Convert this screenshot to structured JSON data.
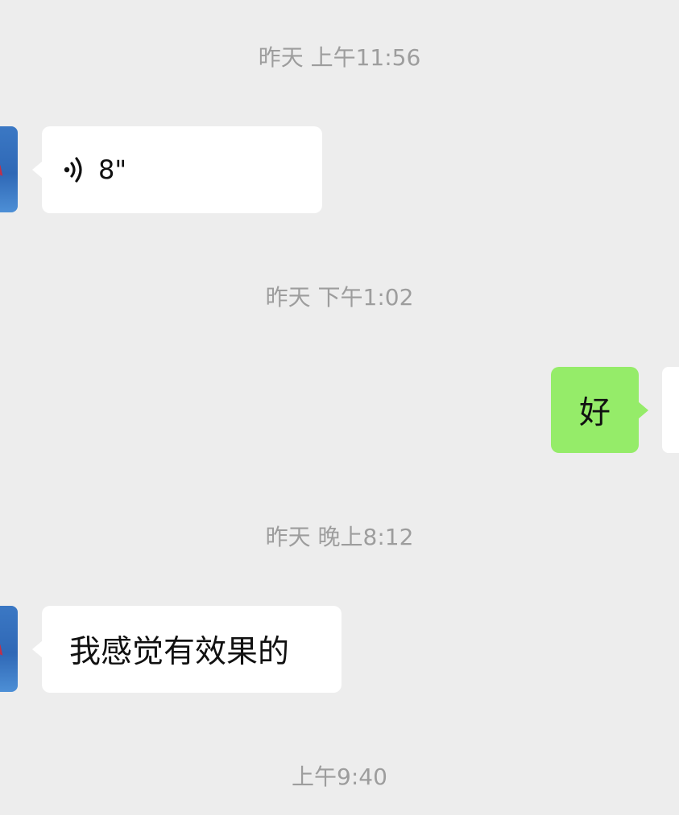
{
  "chat": {
    "timestamp_1": "昨天 上午11:56",
    "voice_message": {
      "duration": "8\"",
      "icon": "voice-wave-icon"
    },
    "timestamp_2": "昨天 下午1:02",
    "sent_message": "好",
    "timestamp_3": "昨天 晚上8:12",
    "received_message": "我感觉有效果的",
    "timestamp_4": "上午9:40"
  },
  "colors": {
    "background": "#ededed",
    "received_bubble": "#ffffff",
    "sent_bubble": "#95ec69",
    "timestamp_text": "#9d9d9d"
  }
}
